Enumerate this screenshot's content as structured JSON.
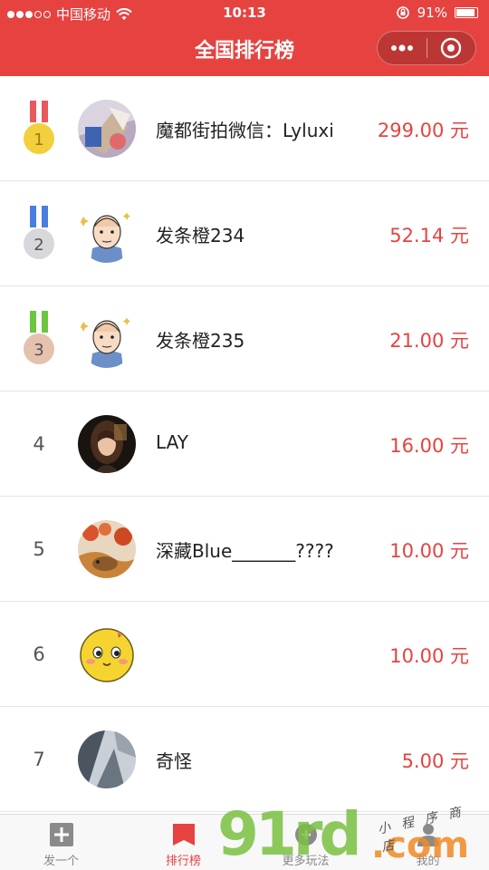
{
  "status": {
    "carrier": "中国移动",
    "time": "10:13",
    "battery": "91%",
    "battery_level": 0.91
  },
  "nav": {
    "title": "全国排行榜"
  },
  "ranking": [
    {
      "rank": "1",
      "name": "魔都街拍微信：Lyluxi",
      "amount": "299.00 元",
      "medal": "gold"
    },
    {
      "rank": "2",
      "name": "发条橙234",
      "amount": "52.14 元",
      "medal": "silver"
    },
    {
      "rank": "3",
      "name": "发条橙235",
      "amount": "21.00 元",
      "medal": "bronze"
    },
    {
      "rank": "4",
      "name": "LAY",
      "amount": "16.00 元"
    },
    {
      "rank": "5",
      "name": "深藏Blue_______????",
      "amount": "10.00 元"
    },
    {
      "rank": "6",
      "name": "",
      "amount": "10.00 元"
    },
    {
      "rank": "7",
      "name": "奇怪",
      "amount": "5.00 元"
    }
  ],
  "tabs": [
    {
      "label": "发一个",
      "icon": "plus-icon",
      "active": false
    },
    {
      "label": "排行榜",
      "icon": "bookmark-icon",
      "active": true
    },
    {
      "label": "更多玩法",
      "icon": "game-icon",
      "active": false
    },
    {
      "label": "我的",
      "icon": "user-icon",
      "active": false
    }
  ],
  "watermark": {
    "digits": "91rd",
    "domain": ".com",
    "tagline": "小 程 序 商 店"
  },
  "colors": {
    "brand": "#e64340",
    "gold": "#f2cf3c",
    "silver": "#d8d8dc",
    "bronze": "#e4c2ae"
  }
}
